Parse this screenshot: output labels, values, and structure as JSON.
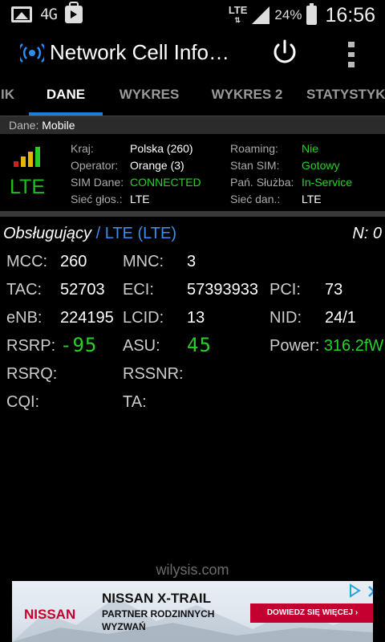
{
  "status_bar": {
    "network_type": "4G",
    "signal_type": "LTE",
    "battery": "24%",
    "time": "16:56"
  },
  "app_bar": {
    "title": "Network Cell Info…"
  },
  "tabs": [
    {
      "label": "IK"
    },
    {
      "label": "DANE"
    },
    {
      "label": "WYKRES"
    },
    {
      "label": "WYKRES 2"
    },
    {
      "label": "STATYSTYKA"
    }
  ],
  "dane_line": {
    "label": "Dane:",
    "value": "Mobile"
  },
  "info_panel": {
    "technology": "LTE",
    "signal_colors": [
      "#d01f1f",
      "#e8b400",
      "#e8b400",
      "#22cc22"
    ],
    "left": [
      {
        "key": "Kraj:",
        "value": "Polska (260)"
      },
      {
        "key": "Operator:",
        "value": "Orange (3)"
      },
      {
        "key": "SIM Dane:",
        "value": "CONNECTED"
      },
      {
        "key": "Sieć głos.:",
        "value": "LTE"
      }
    ],
    "right": [
      {
        "key": "Roaming:",
        "value": "Nie"
      },
      {
        "key": "Stan SIM:",
        "value": "Gotowy"
      },
      {
        "key": "Pań. Służba:",
        "value": "In-Service"
      },
      {
        "key": "Sieć dan.:",
        "value": "LTE"
      }
    ]
  },
  "serving": {
    "title": "Obsługujący",
    "title_tech": "/ LTE (LTE)",
    "n_count": "N: 0",
    "mcc": {
      "key": "MCC:",
      "value": "260"
    },
    "mnc": {
      "key": "MNC:",
      "value": "3"
    },
    "tac": {
      "key": "TAC:",
      "value": "52703"
    },
    "eci": {
      "key": "ECI:",
      "value": "57393933"
    },
    "pci": {
      "key": "PCI:",
      "value": "73"
    },
    "enb": {
      "key": "eNB:",
      "value": "224195"
    },
    "lcid": {
      "key": "LCID:",
      "value": "13"
    },
    "nid": {
      "key": "NID:",
      "value": "24/1"
    },
    "rsrp": {
      "key": "RSRP:",
      "value": "-95"
    },
    "asu": {
      "key": "ASU:",
      "value": "45"
    },
    "power": {
      "key": "Power:",
      "value": "316.2fW"
    },
    "rsrq": {
      "key": "RSRQ:",
      "value": ""
    },
    "rssnr": {
      "key": "RSSNR:",
      "value": ""
    },
    "cqi": {
      "key": "CQI:",
      "value": ""
    },
    "ta": {
      "key": "TA:",
      "value": ""
    }
  },
  "footer": {
    "credit": "wilysis.com"
  },
  "ad": {
    "brand": "NISSAN",
    "title": "NISSAN X-TRAIL",
    "subtitle": "PARTNER RODZINNYCH WYZWAŃ",
    "cta": "DOWIEDZ SIĘ WIĘCEJ ›"
  },
  "colors": {
    "accent": "#1a7fd9",
    "green": "#27d227",
    "brand_red": "#c3002f"
  }
}
